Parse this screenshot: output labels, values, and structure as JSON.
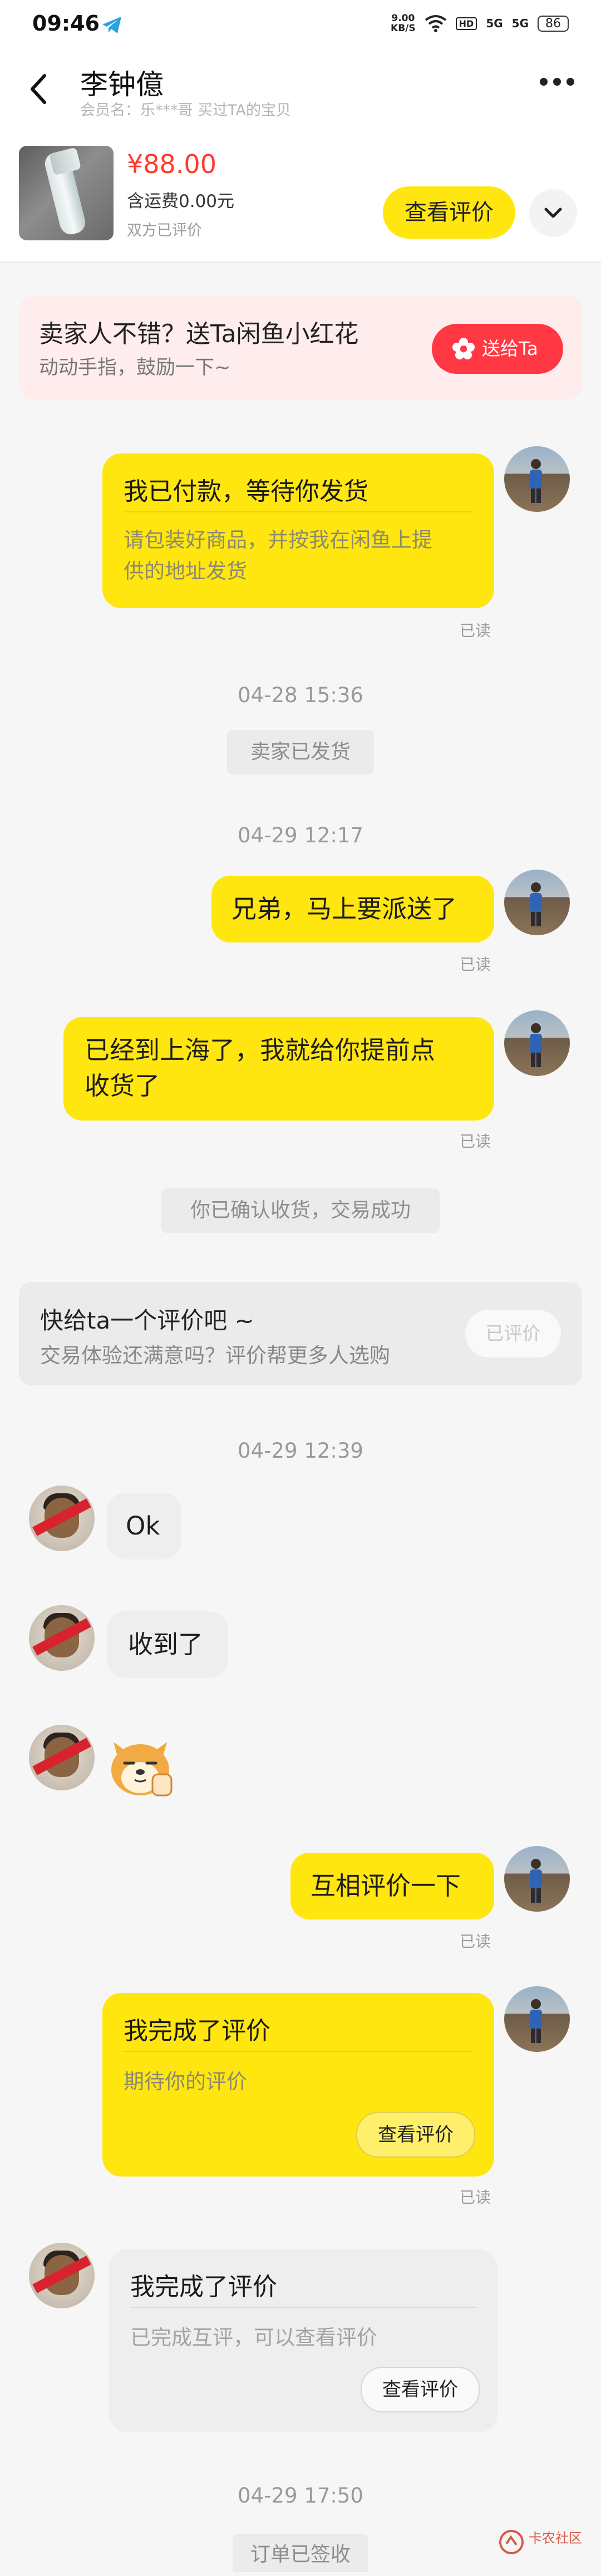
{
  "status_bar": {
    "time": "09:46",
    "speed_value": "9.00",
    "speed_unit": "KB/S",
    "hd": "HD",
    "signal_1": "5G",
    "signal_2": "5G",
    "battery": "86"
  },
  "header": {
    "peer_name": "李钟億",
    "member_line": "会员名：乐***哥    买过TA的宝贝"
  },
  "product": {
    "price": "¥88.00",
    "shipping": "含运费0.00元",
    "review_state": "双方已评价",
    "check_review_label": "查看评价"
  },
  "promo": {
    "title": "卖家人不错？送Ta闲鱼小红花",
    "subtitle": "动动手指，鼓励一下~",
    "button_label": "送给Ta"
  },
  "messages": {
    "paid_card": {
      "title": "我已付款，等待你发货",
      "desc_line1": "请包装好商品，并按我在闲鱼上提",
      "desc_line2": "供的地址发货",
      "read": "已读"
    },
    "time_1": "04-28 15:36",
    "sys_shipped": "卖家已发货",
    "time_2": "04-29 12:17",
    "msg_delivery": {
      "text": "兄弟，马上要派送了",
      "read": "已读"
    },
    "msg_shanghai": {
      "line1": "已经到上海了，我就给你提前点",
      "line2": "收货了",
      "read": "已读"
    },
    "sys_confirmed": "你已确认收货，交易成功",
    "rate_prompt": {
      "title": "快给ta一个评价吧 ~",
      "subtitle": "交易体验还满意吗？评价帮更多人选购",
      "button_label": "已评价"
    },
    "time_3": "04-29 12:39",
    "peer_ok": "Ok",
    "peer_received": "收到了",
    "msg_mutual": {
      "text": "互相评价一下",
      "read": "已读"
    },
    "my_review_card": {
      "title": "我完成了评价",
      "desc": "期待你的评价",
      "button_label": "查看评价",
      "read": "已读"
    },
    "peer_review_card": {
      "title": "我完成了评价",
      "desc": "已完成互评，可以查看评价",
      "button_label": "查看评价"
    },
    "time_4": "04-29 17:50",
    "sys_signed": "订单已签收"
  },
  "watermark": {
    "text": "卡农社区",
    "small": ""
  },
  "colors": {
    "brand_yellow": "#ffe60f",
    "price_red": "#ff3b30",
    "promo_bg": "#ffecec",
    "send_button": "#ff3843"
  },
  "icons": [
    "telegram-icon",
    "wifi-icon",
    "back-arrow-icon",
    "more-dots-icon",
    "chevron-down-icon",
    "flower-icon",
    "doge-emoji-icon"
  ]
}
